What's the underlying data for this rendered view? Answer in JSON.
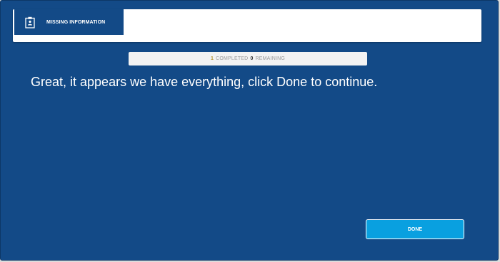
{
  "tabs": [
    {
      "label": "MISSING INFORMATION",
      "icon": "clipboard-icon",
      "active": true
    }
  ],
  "progress": {
    "completed_count": "1",
    "completed_label": "COMPLETED",
    "remaining_count": "0",
    "remaining_label": "REMAINING"
  },
  "main": {
    "message": "Great, it appears we have everything, click Done to continue."
  },
  "footer": {
    "done_label": "DONE"
  },
  "colors": {
    "background": "#134a87",
    "tab_bar": "#ffffff",
    "button": "#09a0e0",
    "completed_number": "#b7952f"
  }
}
